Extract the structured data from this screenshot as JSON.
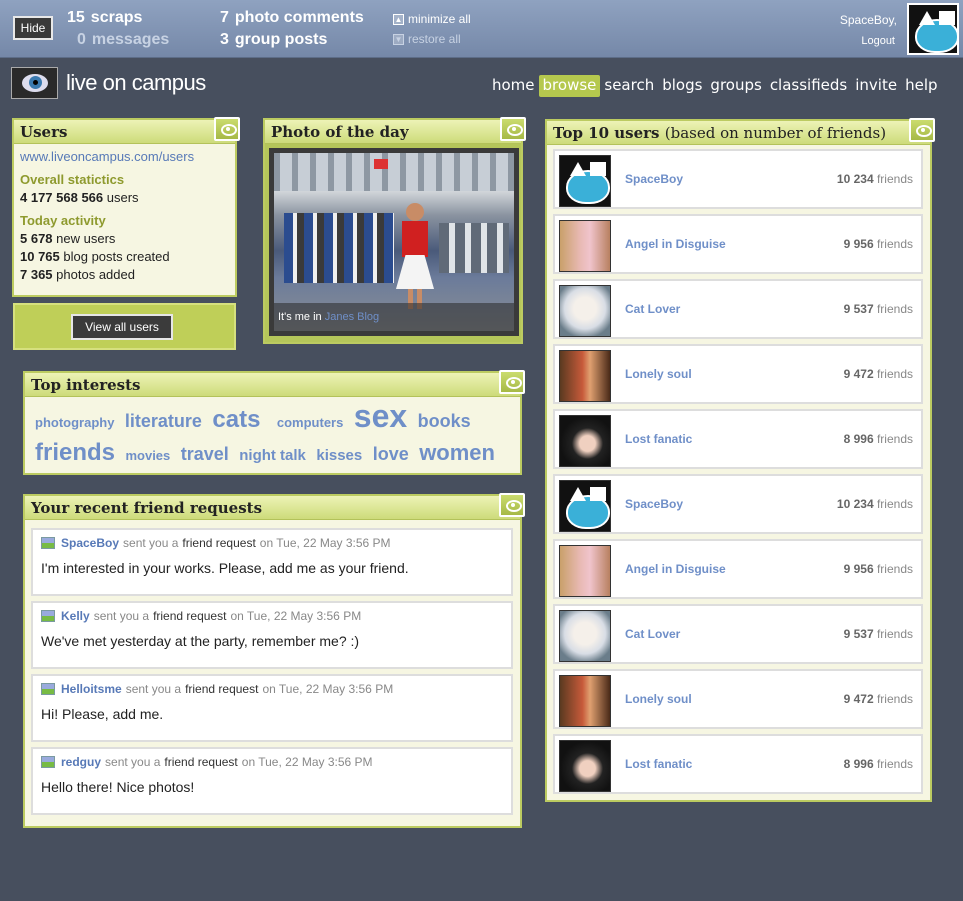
{
  "topbar": {
    "hide_label": "Hide",
    "scraps": {
      "count": "15",
      "label": "scraps"
    },
    "messages": {
      "count": "0",
      "label": "messages"
    },
    "photo_comments": {
      "count": "7",
      "label": "photo comments"
    },
    "group_posts": {
      "count": "3",
      "label": "group posts"
    },
    "minimize_all": "minimize all",
    "restore_all": "restore all",
    "user_name": "SpaceBoy,",
    "logout": "Logout"
  },
  "logo_text": "live on campus",
  "nav": [
    "home",
    "browse",
    "search",
    "blogs",
    "groups",
    "classifieds",
    "invite",
    "help"
  ],
  "nav_active": "browse",
  "users_panel": {
    "title": "Users",
    "url": "www.liveoncampus.com/users",
    "overall_heading": "Overall statictics",
    "overall_count": "4 177 568 566",
    "overall_unit": "users",
    "today_heading": "Today activity",
    "stats": [
      {
        "value": "5 678",
        "label": "new users"
      },
      {
        "value": "10 765",
        "label": "blog posts created"
      },
      {
        "value": "7 365",
        "label": "photos added"
      }
    ],
    "view_all": "View all users"
  },
  "photo_panel": {
    "title": "Photo of the day",
    "caption_prefix": "It's me in",
    "caption_link": "Janes Blog"
  },
  "interests": {
    "title": "Top interests",
    "tags": [
      "photography",
      "literature",
      "cats",
      "computers",
      "sex",
      "books",
      "friends",
      "movies",
      "travel",
      "night talk",
      "kisses",
      "love",
      "women"
    ]
  },
  "requests": {
    "title": "Your recent friend requests",
    "sent_text": "sent you a",
    "request_text": "friend request",
    "on_text": "on Tue, 22 May 3:56 PM",
    "items": [
      {
        "user": "SpaceBoy",
        "message": "I'm interested in your works. Please, add me as your friend."
      },
      {
        "user": "Kelly",
        "message": "We've met yesterday at the party, remember me? :)"
      },
      {
        "user": "Helloitsme",
        "message": "Hi! Please, add me."
      },
      {
        "user": "redguy",
        "message": "Hello there! Nice photos!"
      }
    ]
  },
  "top_users": {
    "title": "Top 10 users",
    "subtitle": "(based on number of friends)",
    "friends_label": "friends",
    "items": [
      {
        "name": "SpaceBoy",
        "friends": "10 234",
        "avatar": "spaceboy-avatar"
      },
      {
        "name": "Angel in Disguise",
        "friends": "9 956",
        "avatar": "angel-avatar"
      },
      {
        "name": "Cat Lover",
        "friends": "9 537",
        "avatar": "cat-lover-avatar"
      },
      {
        "name": "Lonely soul",
        "friends": "9 472",
        "avatar": "lonely-soul-avatar"
      },
      {
        "name": "Lost fanatic",
        "friends": "8 996",
        "avatar": "lost-fanatic-avatar"
      },
      {
        "name": "SpaceBoy",
        "friends": "10 234",
        "avatar": "spaceboy-avatar"
      },
      {
        "name": "Angel in Disguise",
        "friends": "9 956",
        "avatar": "angel-avatar"
      },
      {
        "name": "Cat Lover",
        "friends": "9 537",
        "avatar": "cat-lover-avatar"
      },
      {
        "name": "Lonely soul",
        "friends": "9 472",
        "avatar": "lonely-soul-avatar"
      },
      {
        "name": "Lost fanatic",
        "friends": "8 996",
        "avatar": "lost-fanatic-avatar"
      }
    ]
  },
  "colors": {
    "background": "#474f5e",
    "topbar": "#8fa2c0",
    "accent": "#b5c84e",
    "link": "#5779b7",
    "panel_bg": "#f6f6e2"
  }
}
